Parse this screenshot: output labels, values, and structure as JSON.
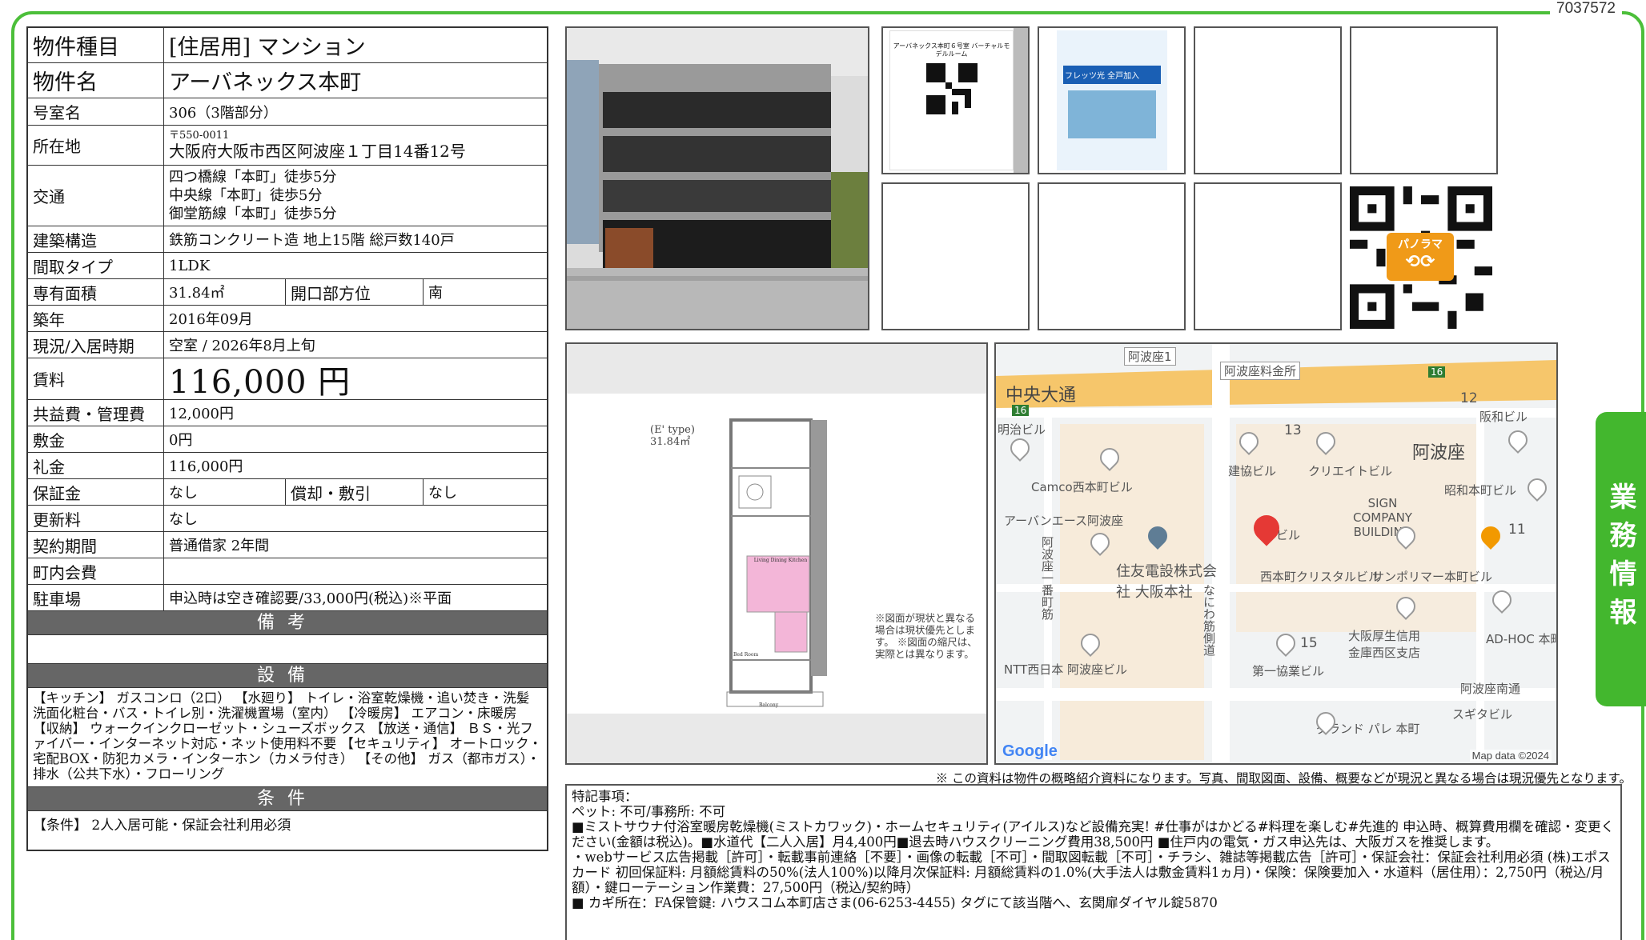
{
  "doc_id": "7037572",
  "side_tab": "業務情報",
  "info": {
    "type_label": "物件種目",
    "type_value": "[住居用] マンション",
    "name_label": "物件名",
    "name_value": "アーバネックス本町",
    "room_label": "号室名",
    "room_value": "306（3階部分）",
    "addr_label": "所在地",
    "addr_zip": "〒550-0011",
    "addr_value": "大阪府大阪市西区阿波座１丁目14番12号",
    "access_label": "交通",
    "access": [
      "四つ橋線「本町」徒歩5分",
      "中央線「本町」徒歩5分",
      "御堂筋線「本町」徒歩5分"
    ],
    "structure_label": "建築構造",
    "structure_value": "鉄筋コンクリート造 地上15階 総戸数140戸",
    "layout_label": "間取タイプ",
    "layout_value": "1LDK",
    "area_label": "専有面積",
    "area_value": "31.84㎡",
    "orient_label": "開口部方位",
    "orient_value": "南",
    "built_label": "築年",
    "built_value": "2016年09月",
    "status_label": "現況/入居時期",
    "status_value": "空室 / 2026年8月上旬",
    "rent_label": "賃料",
    "rent_value": "116,000 円",
    "fee_label": "共益費・管理費",
    "fee_value": "12,000円",
    "deposit_label": "敷金",
    "deposit_value": "0円",
    "keymoney_label": "礼金",
    "keymoney_value": "116,000円",
    "guarantee_label": "保証金",
    "guarantee_value": "なし",
    "amort_label": "償却・敷引",
    "amort_value": "なし",
    "renew_label": "更新料",
    "renew_value": "なし",
    "contract_label": "契約期間",
    "contract_value": "普通借家 2年間",
    "town_label": "町内会費",
    "town_value": "",
    "parking_label": "駐車場",
    "parking_value": "申込時は空き確認要/33,000円(税込)※平面",
    "notes_header": "備考",
    "equip_header": "設備",
    "equip_text": "【キッチン】 ガスコンロ（2口） 【水廻り】 トイレ・浴室乾燥機・追い焚き・洗髪洗面化粧台・バス・トイレ別・洗濯機置場（室内） 【冷暖房】 エアコン・床暖房 【収納】 ウォークインクローゼット・シューズボックス 【放送・通信】 ＢＳ・光ファイバー・インターネット対応・ネット使用料不要 【セキュリティ】 オートロック・宅配BOX・防犯カメラ・インターホン（カメラ付き） 【その他】 ガス（都市ガス）・排水（公共下水）・フローリング",
    "cond_header": "条件",
    "cond_text": "【条件】 2人入居可能・保証会社利用必須"
  },
  "thumbs": {
    "qr_title": "アーバネックス本町６号室 バーチャルモデルルーム",
    "flyer_badge": "フレッツ光 全戸加入",
    "panorama_label": "パノラマ"
  },
  "floorplan": {
    "type_label": "(E' type)",
    "area_label": "31.84㎡",
    "room_ldk": "Living Dining Kitchen",
    "room_bed": "Bed Room",
    "room_bal": "Balcony",
    "note": "※図面が現状と異なる場合は現状優先とします。 ※図面の縮尺は、実際とは異なります。"
  },
  "map": {
    "labels": [
      "阿波座1",
      "阿波座料金所",
      "中央大通",
      "明治ビル",
      "Camco西本町ビル",
      "アーバンエース阿波座",
      "住友電設株式会社 大阪本社",
      "建協ビル",
      "クリエイトビル",
      "阿波座",
      "阪和ビル",
      "昭和本町ビル",
      "SIGN COMPANY BUILDING",
      "西本町クリスタルビル",
      "サンポリマー本町ビル",
      "大阪厚生信用金庫西区支店",
      "AD-HOC 本町",
      "第一協業ビル",
      "NTT西日本 阿波座ビル",
      "阿波座南通",
      "スギタビル",
      "グランド パレ 本町",
      "阿波座一番町筋",
      "なにわ筋側道",
      "13",
      "12",
      "11",
      "15",
      "16",
      "ビル"
    ],
    "logo": "Google",
    "copyright": "Map data ©2024"
  },
  "disclaimer": "※ この資料は物件の概略紹介資料になります。写真、間取図面、設備、概要などが現況と異なる場合は現況優先となります。",
  "special": {
    "lines": [
      "特記事項：",
      "ペット: 不可/事務所: 不可",
      "■ミストサウナ付浴室暖房乾燥機(ミストカワック)・ホームセキュリティ(アイルス)など設備充実! #仕事がはかどる#料理を楽しむ#先進的 申込時、概算費用欄を確認・変更ください(金額は税込)。■水道代【二人入居】月4,400円■退去時ハウスクリーニング費用38,500円 ■住戸内の電気・ガス申込先は、大阪ガスを推奨します。",
      "・webサービス広告掲載［許可］・転載事前連絡［不要］・画像の転載［不可］・間取図転載［不可］・チラシ、雑誌等掲載広告［許可］・保証会社：保証会社利用必須 (株)エポスカード 初回保証料: 月額総賃料の50%(法人100%)以降月次保証料: 月額総賃料の1.0%(大手法人は敷金賃料1ヵ月)・保険：保険要加入・水道料（居住用）：2,750円（税込/月額）・鍵ローテーション作業費：27,500円（税込/契約時）",
      "■ カギ所在：FA保管鍵: ハウスコム本町店さま(06-6253-4455) タグにて該当階へ、玄関扉ダイヤル錠5870"
    ]
  }
}
